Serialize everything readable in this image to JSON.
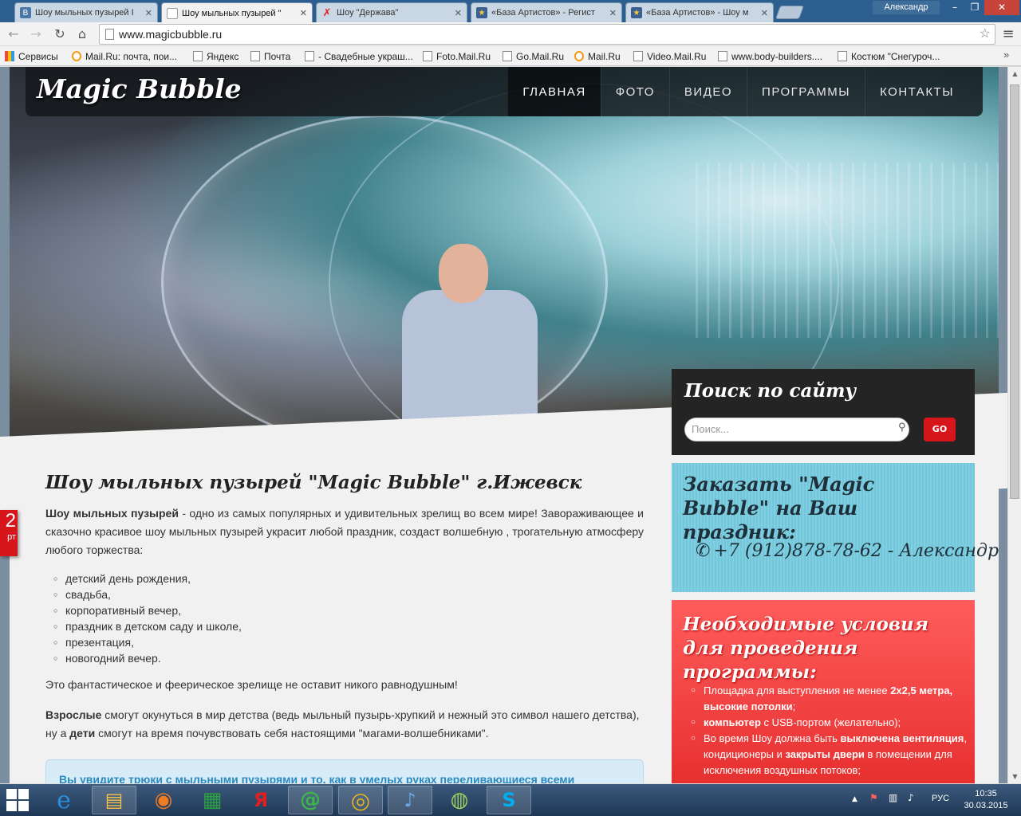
{
  "browser": {
    "tabs": [
      {
        "title": "Шоу мыльных пузырей I",
        "icon": "vk-icon",
        "favicon_color": "#4a76a8",
        "favicon_text": "В"
      },
      {
        "title": "Шоу мыльных пузырей \"",
        "icon": "page-icon",
        "favicon_color": "#ffffff",
        "favicon_text": ""
      },
      {
        "title": "Шоу \"Держава\"",
        "icon": "star-red-icon",
        "favicon_color": "#ffffff",
        "favicon_text": "✗"
      },
      {
        "title": "«База Артистов» - Регист",
        "icon": "star-icon",
        "favicon_color": "#3b5f90",
        "favicon_text": "★"
      },
      {
        "title": "«База Артистов» - Шоу м",
        "icon": "star-icon",
        "favicon_color": "#3b5f90",
        "favicon_text": "★"
      }
    ],
    "user": "Александр",
    "window_controls": {
      "minimize": "–",
      "restore": "❐",
      "close": "✕"
    },
    "nav": {
      "back": "←",
      "forward": "→",
      "reload": "↻",
      "home": "⌂"
    },
    "url": "www.magicbubble.ru",
    "bookmarks": [
      {
        "label": "Сервисы",
        "icon": "apps-icon"
      },
      {
        "label": "Mail.Ru: почта, пои...",
        "icon": "mailru-icon"
      },
      {
        "label": "Яндекс",
        "icon": "page-icon"
      },
      {
        "label": "Почта",
        "icon": "page-icon"
      },
      {
        "label": "- Свадебные украш...",
        "icon": "page-icon"
      },
      {
        "label": "Foto.Mail.Ru",
        "icon": "page-icon"
      },
      {
        "label": "Go.Mail.Ru",
        "icon": "page-icon"
      },
      {
        "label": "Mail.Ru",
        "icon": "mailru-icon"
      },
      {
        "label": "Video.Mail.Ru",
        "icon": "page-icon"
      },
      {
        "label": "www.body-builders....",
        "icon": "page-icon"
      },
      {
        "label": "Костюм \"Снегуроч...",
        "icon": "page-icon"
      }
    ],
    "bookmarks_more": "»"
  },
  "site": {
    "logo": "Magic Bubble",
    "nav": [
      {
        "label": "ГЛАВНАЯ",
        "active": true
      },
      {
        "label": "ФОТО",
        "active": false
      },
      {
        "label": "ВИДЕО",
        "active": false
      },
      {
        "label": "ПРОГРАММЫ",
        "active": false
      },
      {
        "label": "КОНТАКТЫ",
        "active": false
      }
    ],
    "search": {
      "title": "Поиск по сайту",
      "placeholder": "Поиск...",
      "button": "GO"
    },
    "order": {
      "title": "Заказать \"Magic Bubble\" на Ваш праздник:",
      "phone": "+7 (912)878-78-62 - Александр"
    },
    "conditions": {
      "title": "Необходимые условия для проведения программы:",
      "items": [
        {
          "pre": "Площадка для выступления не менее ",
          "bold": "2х2,5 метра, высокие потолки",
          "post": ";"
        },
        {
          "pre": "",
          "bold": "компьютер",
          "post": " с USB-портом (желательно);"
        },
        {
          "pre": "Во время Шоу должна быть ",
          "bold": "выключена вентиляция",
          "post": ", кондиционеры и "
        },
        {
          "pre": "",
          "bold": "закрыты двери",
          "post": " в помещении для исключения воздушных потоков;"
        }
      ]
    },
    "article": {
      "title": "Шоу мыльных пузырей \"Magic Bubble\" г.Ижевск",
      "intro_bold": "Шоу мыльных пузырей",
      "intro_rest": " - одно из самых популярных и удивительных зрелищ во всем мире! Завораживающее и сказочно красивое шоу мыльных пузырей украсит любой праздник, создаст волшебную , трогательную атмосферу любого торжества:",
      "occasions": [
        "детский день рождения,",
        "свадьба,",
        "корпоративный вечер,",
        "праздник в детском саду и школе,",
        "презентация,",
        "новогодний вечер."
      ],
      "p2": "Это фантастическое и феерическое зрелище не оставит никого равнодушным!",
      "p3_bold1": "Взрослые",
      "p3_mid": " смогут окунуться в мир детства (ведь мыльный пузырь-хрупкий и нежный это символ нашего детства), ну а ",
      "p3_bold2": "дети",
      "p3_end": " смогут на время почувствовать себя настоящими \"магами-волшебниками\".",
      "bluebox": "Вы увидите трюки с мыльными пузырями и то, как в умелых руках переливающиеся всеми"
    },
    "side_date": {
      "day": "2",
      "month": "рт"
    }
  },
  "taskbar": {
    "apps": [
      {
        "name": "ie-icon",
        "glyph": "e",
        "color": "#2a8de0"
      },
      {
        "name": "explorer-icon",
        "glyph": "▤",
        "color": "#f3c14a"
      },
      {
        "name": "firefox-icon",
        "glyph": "◉",
        "color": "#f07b22"
      },
      {
        "name": "store-icon",
        "glyph": "▦",
        "color": "#2ea043"
      },
      {
        "name": "yandex-icon",
        "glyph": "Я",
        "color": "#e02020"
      },
      {
        "name": "mail-agent-icon",
        "glyph": "@",
        "color": "#3cb54a"
      },
      {
        "name": "chrome-icon",
        "glyph": "◎",
        "color": "#e2b61e"
      },
      {
        "name": "volume-app-icon",
        "glyph": "♪",
        "color": "#6aa8e8"
      },
      {
        "name": "globe-app-icon",
        "glyph": "◍",
        "color": "#9ccf5a"
      },
      {
        "name": "skype-icon",
        "glyph": "S",
        "color": "#00aff0"
      }
    ],
    "lang": "РУС",
    "time": "10:35",
    "date": "30.03.2015"
  }
}
